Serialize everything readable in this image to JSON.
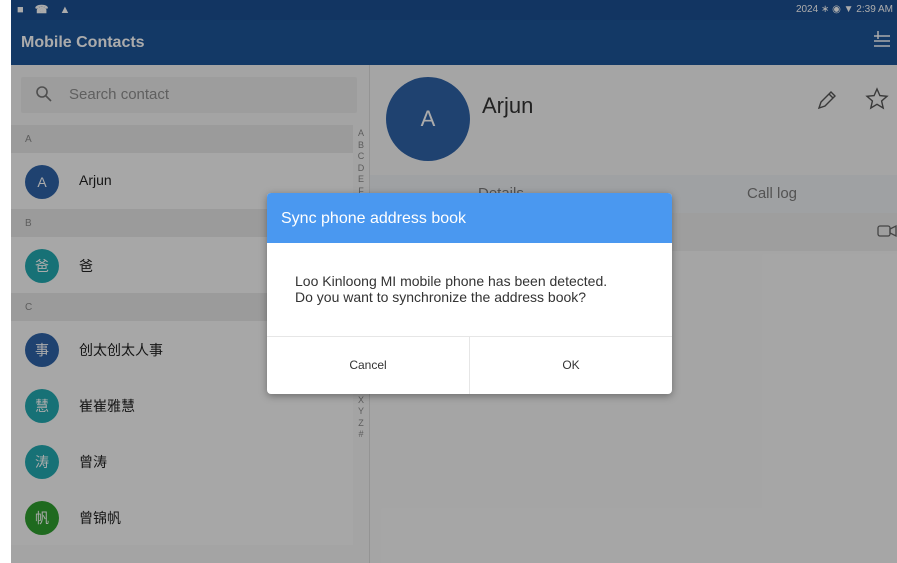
{
  "status_bar": {
    "left_icons": "■ ☎ ▲",
    "right_text": "2024 ∗ ◉ ▼  2:39 AM"
  },
  "app": {
    "title": "Mobile Contacts"
  },
  "search": {
    "placeholder": "Search contact"
  },
  "sections": [
    {
      "label": "A"
    },
    {
      "label": "B"
    },
    {
      "label": "C"
    }
  ],
  "contacts": [
    {
      "initial": "A",
      "name": "Arjun",
      "color": "#2f63a8"
    },
    {
      "initial": "爸",
      "name": "爸",
      "color": "#23a9b0"
    },
    {
      "initial": "事",
      "name": "创太创太人事",
      "color": "#2f63a8"
    },
    {
      "initial": "慧",
      "name": "崔崔雅慧",
      "color": "#23a9b0"
    },
    {
      "initial": "涛",
      "name": "曾涛",
      "color": "#23a9b0"
    },
    {
      "initial": "帆",
      "name": "曾锦帆",
      "color": "#2f9e2f"
    }
  ],
  "alphabet_index": [
    "A",
    "B",
    "C",
    "D",
    "E",
    "F",
    "G",
    "H",
    "I",
    "J",
    "K",
    "L",
    "M",
    "N",
    "O",
    "P",
    "Q",
    "R",
    "S",
    "T",
    "U",
    "V",
    "W",
    "X",
    "Y",
    "Z",
    "#"
  ],
  "detail": {
    "avatar_initial": "A",
    "name": "Arjun",
    "tabs": [
      "Details",
      "Call log"
    ]
  },
  "dialog": {
    "title": "Sync phone address book",
    "message_line1": "Loo Kinloong MI mobile phone has been detected.",
    "message_line2": "Do you want to synchronize the address book?",
    "cancel_label": "Cancel",
    "ok_label": "OK"
  },
  "colors": {
    "app_bar": "#1d5699",
    "dialog_header": "#4a98f0"
  }
}
